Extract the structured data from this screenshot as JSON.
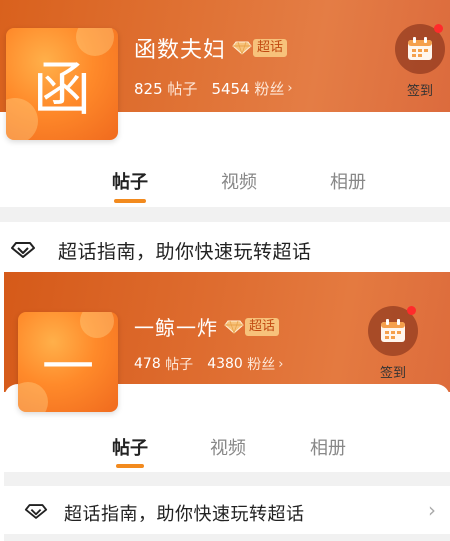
{
  "cards": [
    {
      "avatar_glyph": "函",
      "name": "函数夫妇",
      "badge": "超话",
      "posts_count": "825",
      "posts_label": "帖子",
      "fans_count": "5454",
      "fans_label": "粉丝",
      "signin_label": "签到",
      "tabs": [
        "帖子",
        "视频",
        "相册"
      ],
      "guide_text": "超话指南，助你快速玩转超话"
    },
    {
      "avatar_glyph": "一",
      "name": "一鲸一炸",
      "badge": "超话",
      "posts_count": "478",
      "posts_label": "帖子",
      "fans_count": "4380",
      "fans_label": "粉丝",
      "signin_label": "签到",
      "tabs": [
        "帖子",
        "视频",
        "相册"
      ],
      "guide_text": "超话指南，助你快速玩转超话"
    }
  ],
  "colors": {
    "banner": "#e07336",
    "accent": "#f28a1e",
    "badge_bg": "#f7c27b",
    "badge_text": "#c24a12",
    "notify_dot": "#ff2b2b"
  },
  "icons": {
    "badge": "diamond-icon",
    "signin": "calendar-icon",
    "guide": "diamond-outline-icon",
    "chevron": "chevron-right-icon"
  }
}
